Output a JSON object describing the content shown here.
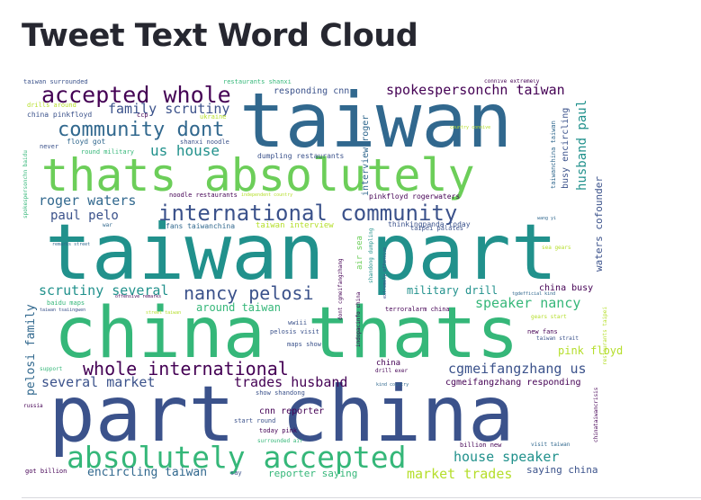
{
  "title": "Tweet Text Word Cloud",
  "colors": {
    "purple": "#440154",
    "navy": "#3b528b",
    "blue": "#31688e",
    "teal": "#21918c",
    "green": "#35b779",
    "lime": "#6cce59",
    "yellow": "#b5de2b"
  },
  "words": [
    {
      "text": "taiwan",
      "color": "#31688e"
    },
    {
      "text": "thats absolutely",
      "color": "#6cce59"
    },
    {
      "text": "taiwan part",
      "color": "#21918c"
    },
    {
      "text": "china thats",
      "color": "#35b779"
    },
    {
      "text": "part china",
      "color": "#3b528b"
    },
    {
      "text": "accepted whole",
      "color": "#440154"
    },
    {
      "text": "absolutely accepted",
      "color": "#35b779"
    },
    {
      "text": "community dont",
      "color": "#31688e"
    },
    {
      "text": "international community",
      "color": "#3b528b"
    },
    {
      "text": "nancy pelosi",
      "color": "#3b528b"
    },
    {
      "text": "whole international",
      "color": "#440154"
    },
    {
      "text": "spokespersonchn taiwan",
      "color": "#440154"
    },
    {
      "text": "family scrutiny",
      "color": "#3b528b"
    },
    {
      "text": "us house",
      "color": "#21918c"
    },
    {
      "text": "roger waters",
      "color": "#31688e"
    },
    {
      "text": "paul pelo",
      "color": "#3b528b"
    },
    {
      "text": "scrutiny several",
      "color": "#21918c"
    },
    {
      "text": "speaker nancy",
      "color": "#35b779"
    },
    {
      "text": "cgmeifangzhang us",
      "color": "#3b528b"
    },
    {
      "text": "several market",
      "color": "#3b528b"
    },
    {
      "text": "trades husband",
      "color": "#440154"
    },
    {
      "text": "house speaker",
      "color": "#21918c"
    },
    {
      "text": "market trades",
      "color": "#b5de2b"
    },
    {
      "text": "encircling taiwan",
      "color": "#31688e"
    },
    {
      "text": "saying china",
      "color": "#3b528b"
    },
    {
      "text": "reporter saying",
      "color": "#35b779"
    },
    {
      "text": "military drill",
      "color": "#21918c"
    },
    {
      "text": "around taiwan",
      "color": "#35b779"
    },
    {
      "text": "husband paul",
      "color": "#21918c"
    },
    {
      "text": "waters cofounder",
      "color": "#3b528b"
    },
    {
      "text": "busy encircling",
      "color": "#3b528b"
    },
    {
      "text": "pelosi family",
      "color": "#31688e"
    },
    {
      "text": "pink floyd",
      "color": "#b5de2b"
    },
    {
      "text": "china busy",
      "color": "#440154"
    },
    {
      "text": "cgmeifangzhang responding",
      "color": "#440154"
    },
    {
      "text": "cnn reporter",
      "color": "#440154"
    },
    {
      "text": "responding cnn",
      "color": "#3b528b"
    },
    {
      "text": "taiwan interview",
      "color": "#b5de2b"
    },
    {
      "text": "interview roger",
      "color": "#31688e"
    },
    {
      "text": "pinkfloyd rogerwaters",
      "color": "#440154"
    },
    {
      "text": "thinkingpanda today",
      "color": "#3b528b"
    },
    {
      "text": "fans taiwanchina",
      "color": "#31688e"
    },
    {
      "text": "noodle restaurants",
      "color": "#440154"
    },
    {
      "text": "dumpling restaurants",
      "color": "#3b528b"
    },
    {
      "text": "shanxi noodle",
      "color": "#3b528b"
    },
    {
      "text": "floyd got",
      "color": "#31688e"
    },
    {
      "text": "round military",
      "color": "#35b779"
    },
    {
      "text": "china pinkfloyd",
      "color": "#3b528b"
    },
    {
      "text": "drills around",
      "color": "#b5de2b"
    },
    {
      "text": "taiwan surrounded",
      "color": "#3b528b"
    },
    {
      "text": "restaurants shanxi",
      "color": "#35b779"
    },
    {
      "text": "ukraine",
      "color": "#b5de2b"
    },
    {
      "text": "ccp",
      "color": "#440154"
    },
    {
      "text": "never",
      "color": "#3b528b"
    },
    {
      "text": "connive extremely",
      "color": "#440154"
    },
    {
      "text": "taiwanchina taiwan",
      "color": "#31688e"
    },
    {
      "text": "spokespersonchn baidu",
      "color": "#35b779"
    },
    {
      "text": "baidu maps",
      "color": "#35b779"
    },
    {
      "text": "terroralarm china",
      "color": "#440154"
    },
    {
      "text": "drill exer",
      "color": "#440154"
    },
    {
      "text": "show shandong",
      "color": "#3b528b"
    },
    {
      "text": "maps show",
      "color": "#3b528b"
    },
    {
      "text": "pelosis visit",
      "color": "#3b528b"
    },
    {
      "text": "today pink",
      "color": "#440154"
    },
    {
      "text": "start round",
      "color": "#3b528b"
    },
    {
      "text": "surrounded air",
      "color": "#35b779"
    },
    {
      "text": "billion new",
      "color": "#440154"
    },
    {
      "text": "visit taiwan",
      "color": "#31688e"
    },
    {
      "text": "got billion",
      "color": "#440154"
    },
    {
      "text": "say",
      "color": "#3b528b"
    },
    {
      "text": "russia",
      "color": "#440154"
    },
    {
      "text": "support",
      "color": "#35b779"
    },
    {
      "text": "new fans",
      "color": "#440154"
    },
    {
      "text": "taiwan strait",
      "color": "#3b528b"
    },
    {
      "text": "gears start",
      "color": "#b5de2b"
    },
    {
      "text": "sea gears",
      "color": "#b5de2b"
    },
    {
      "text": "taipei palates",
      "color": "#3b528b"
    },
    {
      "text": "china",
      "color": "#440154"
    },
    {
      "text": "wwiii",
      "color": "#3b528b"
    },
    {
      "text": "kind country",
      "color": "#31688e"
    },
    {
      "text": "shandong dumpling",
      "color": "#21918c"
    },
    {
      "text": "indopacinfo china",
      "color": "#440154"
    },
    {
      "text": "dont cgmeifangzhang",
      "color": "#440154"
    },
    {
      "text": "air sea",
      "color": "#6cce59"
    },
    {
      "text": "extremely offensive",
      "color": "#3b528b"
    },
    {
      "text": "remarks street",
      "color": "#31688e"
    },
    {
      "text": "offensive remarks",
      "color": "#440154"
    },
    {
      "text": "taiwan tsaiingwen",
      "color": "#3b528b"
    },
    {
      "text": "street taiwan",
      "color": "#b5de2b"
    },
    {
      "text": "chinataiwancrisis",
      "color": "#440154"
    },
    {
      "text": "restaurants taipei",
      "color": "#b5de2b"
    },
    {
      "text": "independent country",
      "color": "#b5de2b"
    },
    {
      "text": "wang yi",
      "color": "#31688e"
    },
    {
      "text": "tgdefficial kind",
      "color": "#31688e"
    },
    {
      "text": "war",
      "color": "#31688e"
    },
    {
      "text": "country connive",
      "color": "#b5de2b"
    }
  ]
}
